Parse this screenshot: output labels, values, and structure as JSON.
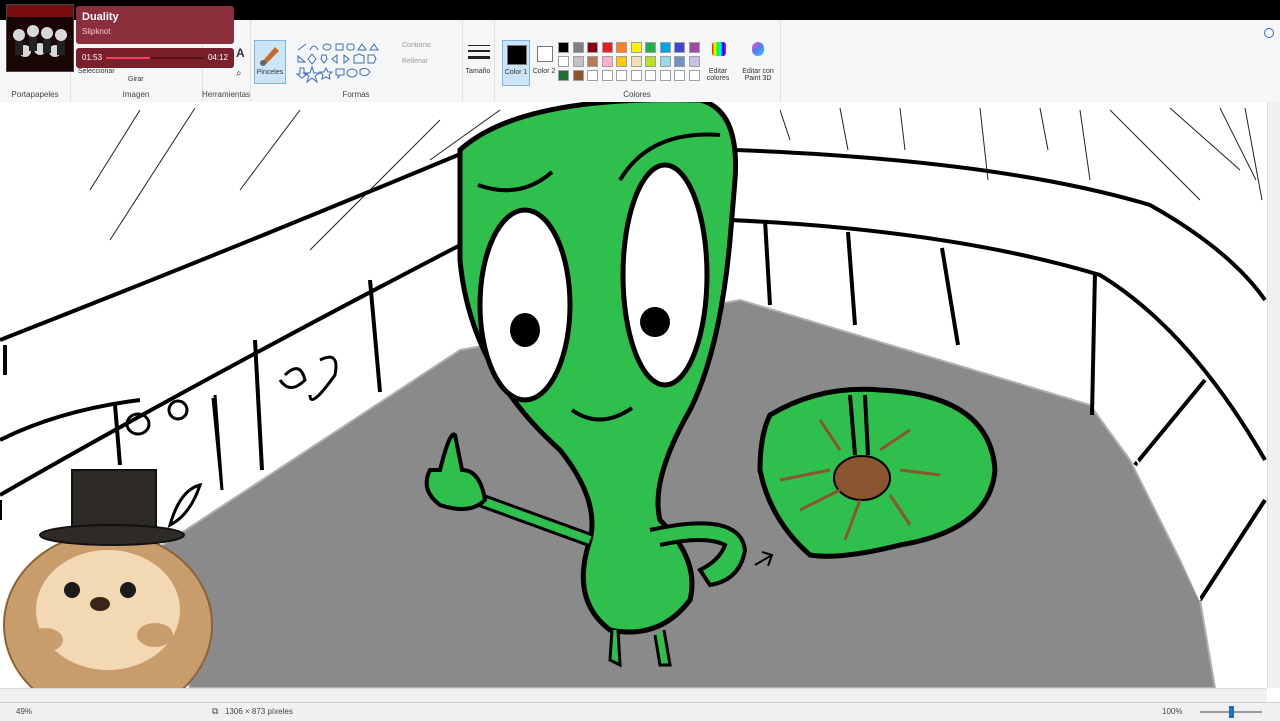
{
  "app": {
    "name": "Paint"
  },
  "ribbon": {
    "groups": {
      "clipboard": "Portapapeles",
      "image": "Imagen",
      "tools": "Herramientas",
      "shapes": "Formas",
      "colors": "Colores"
    },
    "brushes_label": "Pinceles",
    "outline_label": "Contorno",
    "fill_label": "Rellenar",
    "size_label": "Tamaño",
    "color1_label": "Color 1",
    "color2_label": "Color 2",
    "edit_colors_label": "Editar colores",
    "paint3d_label": "Editar con Paint 3D",
    "select_label": "Seleccionar",
    "rotate_label": "Girar"
  },
  "palette": {
    "row1": [
      "#000000",
      "#7f7f7f",
      "#880015",
      "#ed1c24",
      "#ff7f27",
      "#fff200",
      "#22b14c",
      "#00a2e8",
      "#3f48cc",
      "#a349a4"
    ],
    "row2": [
      "#ffffff",
      "#c3c3c3",
      "#b97a57",
      "#ffaec9",
      "#ffc90e",
      "#efe4b0",
      "#b5e61d",
      "#99d9ea",
      "#7092be",
      "#c8bfe7"
    ],
    "row3": [
      "#1f6e3a",
      "#8a5530",
      "#ffffff",
      "#ffffff",
      "#ffffff",
      "#ffffff",
      "#ffffff",
      "#ffffff",
      "#ffffff",
      "#ffffff"
    ]
  },
  "colors": {
    "primary": "#000000",
    "secondary": "#ffffff",
    "alien_green": "#2fbf4c",
    "floor_gray": "#8a8a8a"
  },
  "media": {
    "title": "Duality",
    "artist": "Slipknot",
    "elapsed": "01:53",
    "total": "04:12",
    "progress": 0.45
  },
  "status": {
    "dimensions": "1306 × 873 píxeles",
    "zoom": "100%",
    "left_zoom": "49%"
  }
}
